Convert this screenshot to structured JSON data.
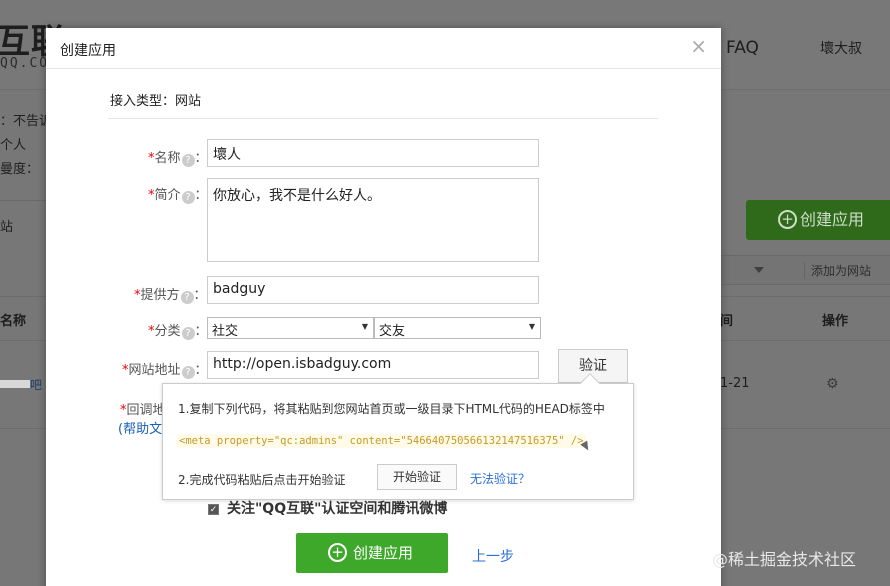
{
  "background": {
    "logo_text": "互联",
    "logo_sub": "QQ.CO",
    "nav_faq": "FAQ",
    "nav_user": "壞大叔",
    "left_line1": "：不告诉",
    "left_line2": "个人",
    "left_line3": "曼度：",
    "left_tab": "站",
    "create_app_btn": "创建应用",
    "add_site_btn": "添加为网站",
    "col_name": "名称",
    "col_time": "间",
    "col_ops": "操作",
    "row_date": "1-21",
    "row_suffix": "吧"
  },
  "modal": {
    "title": "创建应用",
    "close": "×",
    "access_type_label": "接入类型：",
    "access_type_value": "网站",
    "fields": {
      "name_label": "名称",
      "name_value": "壞人",
      "intro_label": "简介",
      "intro_value": "你放心，我不是什么好人。",
      "provider_label": "提供方",
      "provider_value": "badguy",
      "category_label": "分类",
      "category_value1": "社交",
      "category_value2": "交友",
      "site_label": "网站地址",
      "site_value": "http://open.isbadguy.com",
      "callback_label": "回调地",
      "colon": "："
    },
    "verify_btn": "验证",
    "help_link": "(帮助文",
    "popover": {
      "step1": "1.复制下列代码，将其粘贴到您网站首页或一级目录下HTML代码的HEAD标签中",
      "code": "<meta property=\"qc:admins\" content=\"5466407505661321475163​75\" />",
      "step2": "2.完成代码粘贴后点击开始验证",
      "start_btn": "开始验证",
      "cant_verify": "无法验证？"
    },
    "follow_text": "关注\"QQ互联\"认证空间和腾讯微博",
    "create_btn": "创建应用",
    "prev_link": "上一步"
  },
  "watermark": "@稀土掘金技术社区",
  "colors": {
    "accent_green": "#3ea82a",
    "link_blue": "#2a6fd6",
    "code_orange": "#c69a2a",
    "required_red": "#e00000"
  }
}
